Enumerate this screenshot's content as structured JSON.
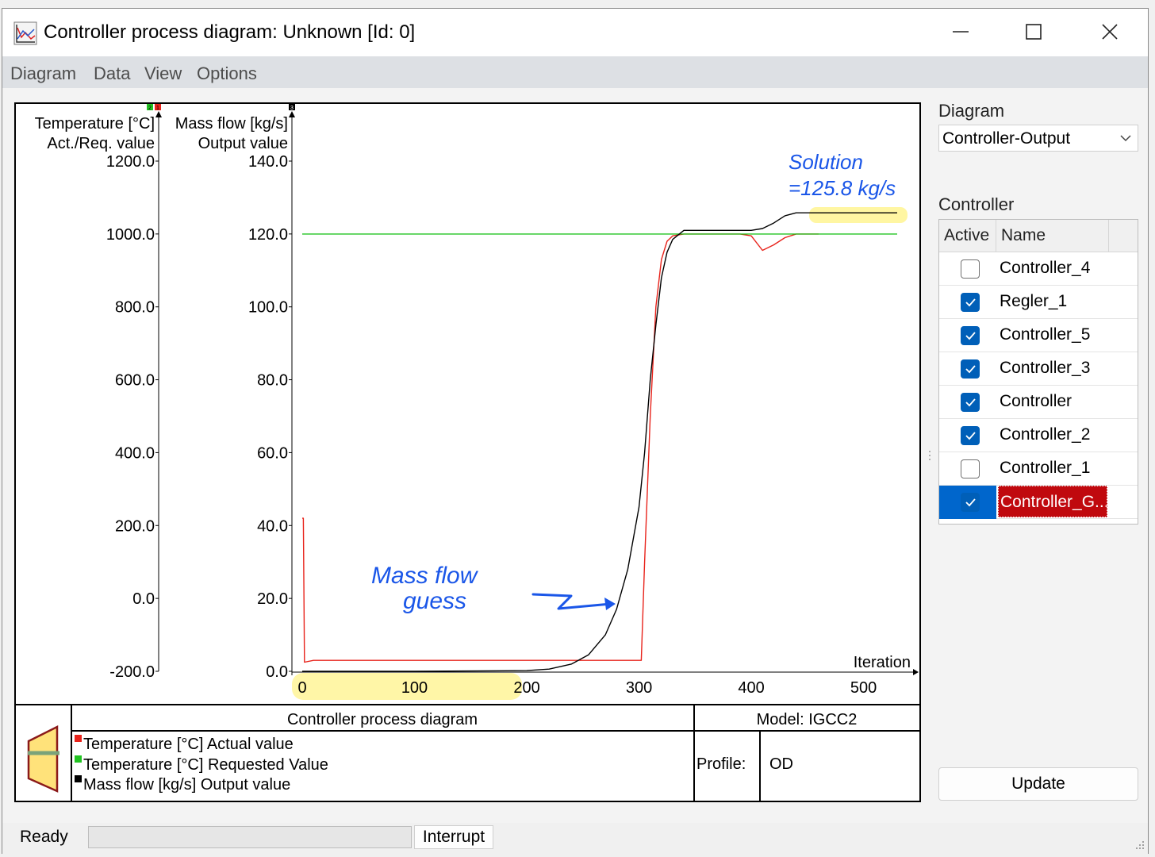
{
  "window": {
    "title": "Controller process diagram: Unknown [Id: 0]",
    "icon": "chart-app-icon",
    "controls": [
      "minimize-icon",
      "maximize-icon",
      "close-icon"
    ]
  },
  "menu": {
    "items": [
      "Diagram",
      "Data",
      "View",
      "Options"
    ]
  },
  "plot": {
    "temp_axis_label": "Temperature [°C]",
    "temp_axis_sublabel": "Act./Req. value",
    "temp_ticks": [
      "1200.0",
      "1000.0",
      "800.0",
      "600.0",
      "400.0",
      "200.0",
      "0.0",
      "-200.0"
    ],
    "mass_axis_label": "Mass flow [kg/s]",
    "mass_axis_sublabel": "Output value",
    "mass_ticks": [
      "140.0",
      "120.0",
      "100.0",
      "80.0",
      "60.0",
      "40.0",
      "20.0",
      "0.0"
    ],
    "x_label": "Iteration",
    "x_ticks": [
      "0",
      "100",
      "200",
      "300",
      "400",
      "500"
    ],
    "axis_markers": [
      "2",
      "1",
      "3"
    ],
    "annotation_mass_flow_1": "Mass flow",
    "annotation_mass_flow_2": "guess",
    "annotation_solution_1": "Solution",
    "annotation_solution_2": "=125.8 kg/s",
    "highlight_color": "#fff59d",
    "annotation_color": "#1a56e8"
  },
  "chart_data": {
    "type": "line",
    "xlabel": "Iteration",
    "xlim": [
      0,
      530
    ],
    "axes": [
      {
        "label": "Temperature [°C] Act./Req. value",
        "ylim": [
          -200,
          1200
        ]
      },
      {
        "label": "Mass flow [kg/s] Output value",
        "ylim": [
          0,
          140
        ]
      }
    ],
    "series": [
      {
        "name": "Temperature [°C] Actual value",
        "color": "#e8231b",
        "axis": "Mass flow [kg/s] Output value",
        "x": [
          0,
          1,
          2,
          10,
          50,
          100,
          200,
          250,
          300,
          302,
          305,
          310,
          315,
          320,
          325,
          330,
          340,
          360,
          390,
          400,
          410,
          420,
          430,
          440,
          450,
          460
        ],
        "y": [
          42,
          42,
          2.5,
          3,
          3,
          3,
          3,
          3,
          3,
          3,
          30,
          70,
          100,
          113,
          118,
          119.5,
          120,
          120,
          120,
          119.5,
          115.5,
          117,
          119,
          120,
          120,
          120
        ]
      },
      {
        "name": "Temperature [°C] Requested Value",
        "color": "#22c322",
        "axis": "Mass flow [kg/s] Output value",
        "x": [
          0,
          530
        ],
        "y": [
          120,
          120
        ]
      },
      {
        "name": "Mass flow [kg/s] Output value",
        "color": "#000000",
        "axis": "Mass flow [kg/s] Output value",
        "x": [
          0,
          100,
          200,
          220,
          240,
          255,
          270,
          280,
          290,
          300,
          305,
          310,
          315,
          320,
          325,
          330,
          340,
          360,
          380,
          400,
          410,
          420,
          430,
          440,
          450,
          530
        ],
        "y": [
          0,
          0,
          0.2,
          0.6,
          2,
          4.5,
          10,
          17,
          28,
          45,
          60,
          80,
          95,
          108,
          115,
          118.5,
          121,
          121,
          121,
          121,
          121.5,
          123,
          125,
          125.8,
          125.8,
          125.8
        ]
      }
    ]
  },
  "legend": {
    "title": "Controller process diagram",
    "items": [
      {
        "label": "Temperature [°C] Actual value",
        "color": "#e8231b"
      },
      {
        "label": "Temperature [°C] Requested Value",
        "color": "#22c322"
      },
      {
        "label": "Mass flow [kg/s] Output value",
        "color": "#000000"
      }
    ],
    "model": "Model: IGCC2",
    "profile_label": "Profile:",
    "profile_value": "OD"
  },
  "side_panel": {
    "diagram_label": "Diagram",
    "diagram_value": "Controller-Output",
    "controller_label": "Controller",
    "columns": [
      "Active",
      "Name"
    ],
    "controllers": [
      {
        "name": "Controller_4",
        "active": false
      },
      {
        "name": "Regler_1",
        "active": true
      },
      {
        "name": "Controller_5",
        "active": true
      },
      {
        "name": "Controller_3",
        "active": true
      },
      {
        "name": "Controller",
        "active": true
      },
      {
        "name": "Controller_2",
        "active": true
      },
      {
        "name": "Controller_1",
        "active": false
      },
      {
        "name": "Controller_G...",
        "active": true,
        "selected": true
      }
    ],
    "update_label": "Update",
    "selected_row_color": "#0066cc",
    "selected_name_color": "#c0090e"
  },
  "status": {
    "text": "Ready",
    "interrupt_label": "Interrupt"
  }
}
